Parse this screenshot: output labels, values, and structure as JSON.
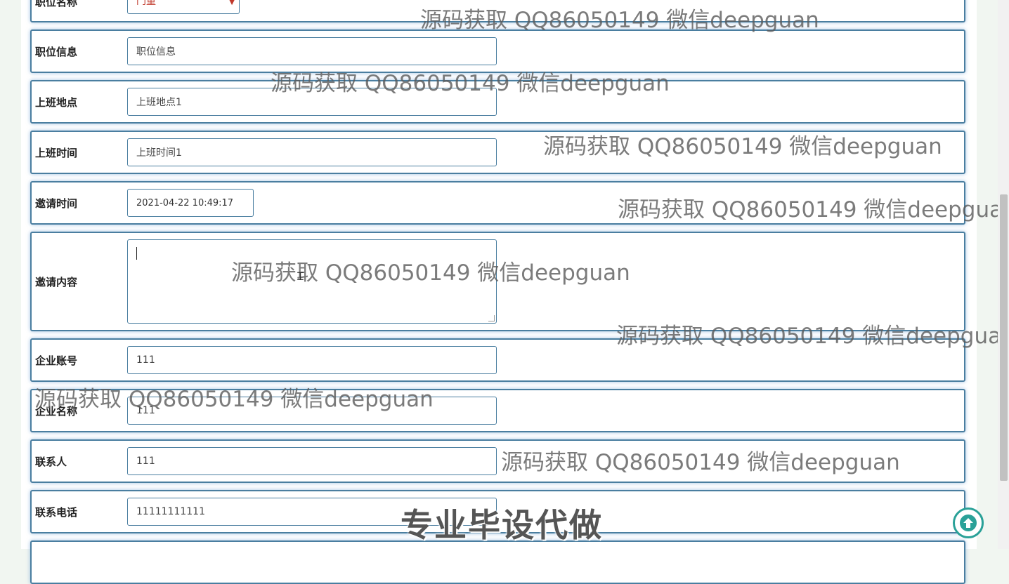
{
  "form": {
    "rows": [
      {
        "label": "职位名称",
        "value": "门童"
      },
      {
        "label": "职位信息",
        "value": "职位信息"
      },
      {
        "label": "上班地点",
        "value": "上班地点1"
      },
      {
        "label": "上班时间",
        "value": "上班时间1"
      },
      {
        "label": "邀请时间",
        "value": "2021-04-22 10:49:17"
      },
      {
        "label": "邀请内容",
        "value": ""
      },
      {
        "label": "企业账号",
        "value": "111"
      },
      {
        "label": "企业名称",
        "value": "111"
      },
      {
        "label": "联系人",
        "value": "111"
      },
      {
        "label": "联系电话",
        "value": "11111111111"
      }
    ]
  },
  "watermark": "源码获取 QQ86050149 微信deepguan",
  "promo": "专业毕设代做",
  "icons": {
    "back_to_top": "arrow-up-circle-icon",
    "select_chevron": "chevron-down-icon"
  },
  "colors": {
    "border": "#4a7ea0",
    "accent": "#2aa198",
    "page_bg": "#f1f6f1"
  }
}
